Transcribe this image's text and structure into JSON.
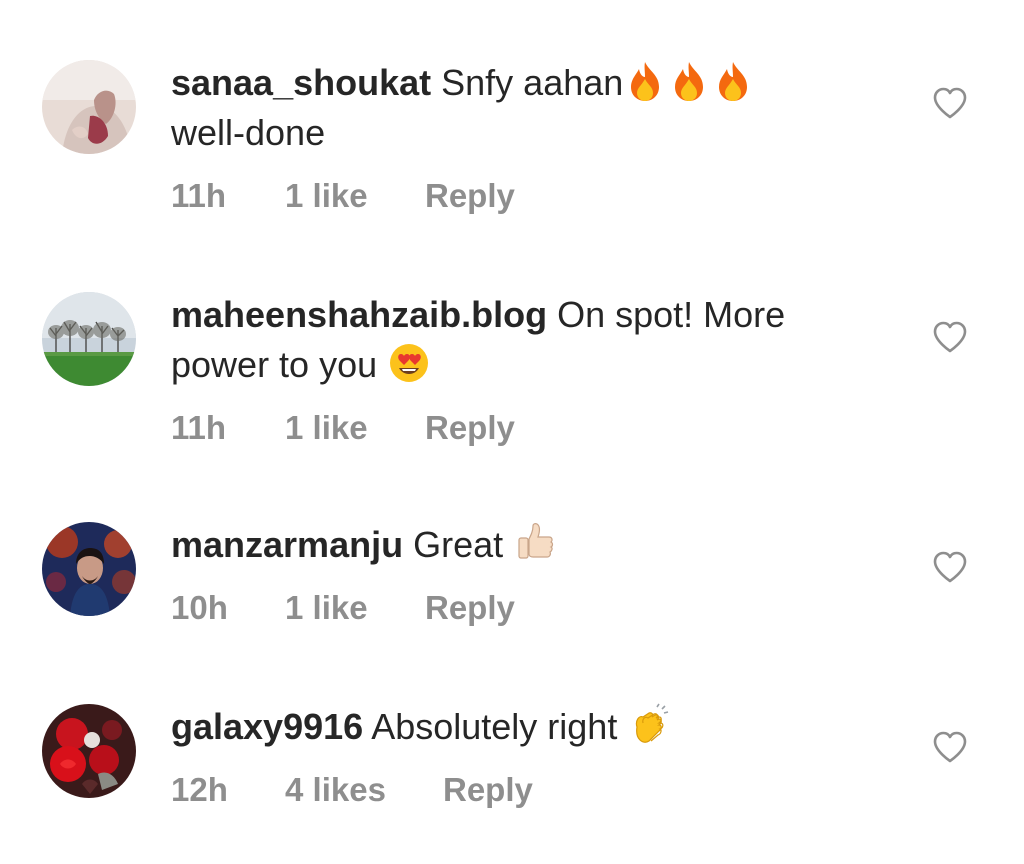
{
  "comments": [
    {
      "username": "sanaa_shoukat",
      "text_line1": "Snfy aahan",
      "text_line2": "well-done",
      "time": "11h",
      "likes": "1 like",
      "reply": "Reply",
      "emoji": [
        "fire",
        "fire",
        "fire"
      ]
    },
    {
      "username": "maheenshahzaib.blog",
      "text_line1": "On spot! More",
      "text_line2": "power to you",
      "time": "11h",
      "likes": "1 like",
      "reply": "Reply",
      "emoji": [
        "heart-eyes-face"
      ]
    },
    {
      "username": "manzarmanju",
      "text_line1": "Great",
      "time": "10h",
      "likes": "1 like",
      "reply": "Reply",
      "emoji": [
        "thumbs-up"
      ]
    },
    {
      "username": "galaxy9916",
      "text_line1": "Absolutely right",
      "time": "12h",
      "likes": "4 likes",
      "reply": "Reply",
      "emoji": [
        "clapping-hands"
      ]
    }
  ],
  "colors": {
    "text": "#262626",
    "secondary": "#8e8e8e",
    "heart_outline": "#8e8e8e"
  },
  "icons": {
    "like": "heart-outline-icon"
  }
}
